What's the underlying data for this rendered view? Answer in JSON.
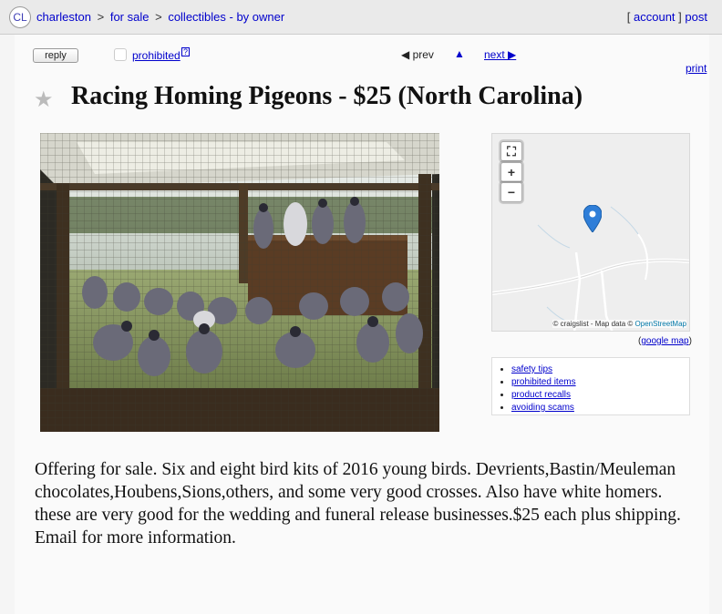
{
  "header": {
    "logo_text": "CL",
    "breadcrumbs": [
      "charleston",
      "for sale",
      "collectibles - by owner"
    ],
    "separator": ">",
    "account_label": "account",
    "post_label": "post",
    "bracket_open": "[",
    "bracket_close": "]"
  },
  "toolbar": {
    "reply_label": "reply",
    "prohibited_label": "prohibited",
    "prohibited_help": "?",
    "prev_label": "◀ prev",
    "up_label": "▲",
    "next_label": "next ▶",
    "print_label": "print"
  },
  "posting": {
    "title": "Racing Homing Pigeons - $25 (North Carolina)",
    "body": "Offering for sale. Six and eight bird kits of 2016 young birds. Devrients,Bastin/Meuleman chocolates,Houbens,Sions,others, and some very good crosses. Also have white homers. these are very good for the wedding and funeral release businesses.$25 each plus shipping. Email for more information."
  },
  "map": {
    "fullscreen_icon": "fullscreen-icon",
    "zoom_in": "+",
    "zoom_out": "−",
    "attribution_prefix": "© craigslist - Map data ©",
    "attribution_link": "OpenStreetMap",
    "google_map_label": "google map",
    "google_paren_open": "(",
    "google_paren_close": ")",
    "pin_color": "#2f7ed8"
  },
  "safety_links": [
    "safety tips",
    "prohibited items",
    "product recalls",
    "avoiding scams"
  ],
  "colors": {
    "link": "#0000cc",
    "topbar": "#eaeaea",
    "background": "#f5f5f5"
  }
}
